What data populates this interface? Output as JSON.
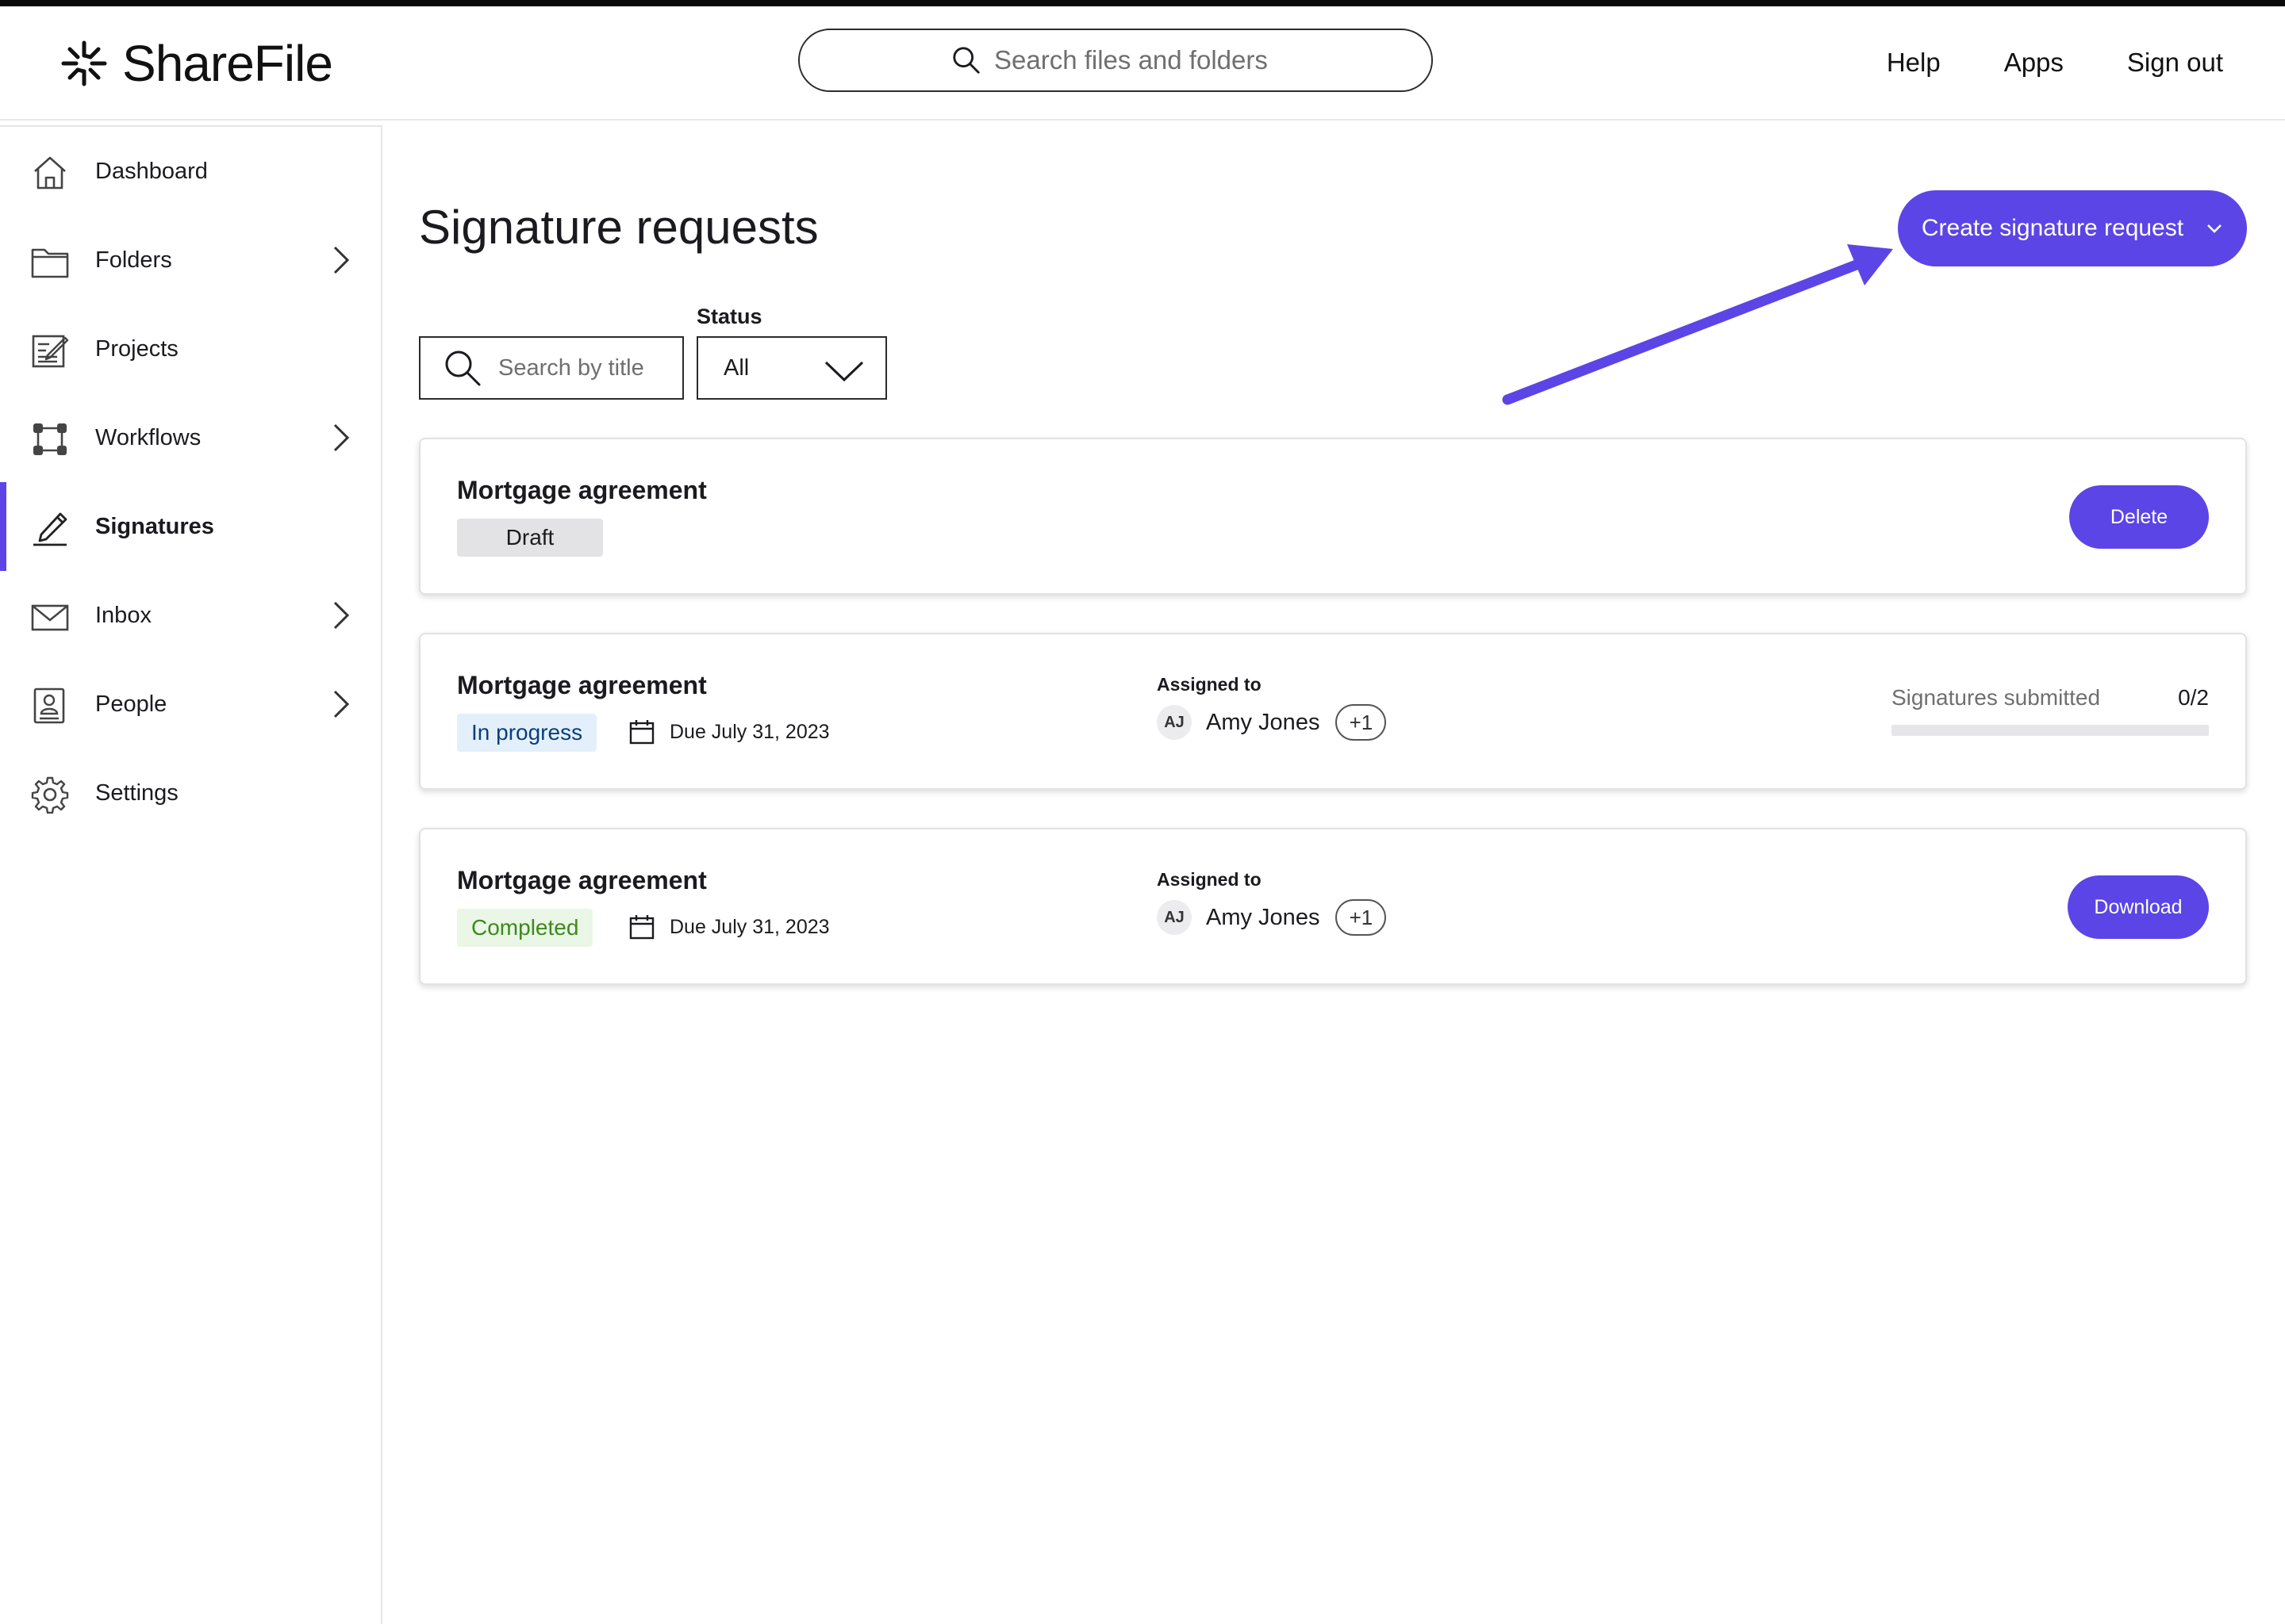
{
  "header": {
    "brand": "ShareFile",
    "search_placeholder": "Search files and folders",
    "nav": {
      "help": "Help",
      "apps": "Apps",
      "sign_out": "Sign out"
    }
  },
  "sidebar": {
    "items": [
      {
        "label": "Dashboard",
        "icon": "home-icon"
      },
      {
        "label": "Folders",
        "icon": "folder-icon",
        "expandable": true
      },
      {
        "label": "Projects",
        "icon": "projects-icon"
      },
      {
        "label": "Workflows",
        "icon": "workflows-icon",
        "expandable": true
      },
      {
        "label": "Signatures",
        "icon": "signature-pen-icon",
        "active": true
      },
      {
        "label": "Inbox",
        "icon": "envelope-icon",
        "expandable": true
      },
      {
        "label": "People",
        "icon": "contact-book-icon",
        "expandable": true
      },
      {
        "label": "Settings",
        "icon": "gear-icon"
      }
    ]
  },
  "main": {
    "title": "Signature requests",
    "create_button": "Create signature request",
    "filters": {
      "search_placeholder": "Search by title",
      "status_label": "Status",
      "status_value": "All"
    },
    "requests": [
      {
        "title": "Mortgage agreement",
        "status": "Draft",
        "action": "Delete"
      },
      {
        "title": "Mortgage agreement",
        "status": "In progress",
        "due": "Due July 31, 2023",
        "assigned_label": "Assigned to",
        "assignee_initials": "AJ",
        "assignee_name": "Amy Jones",
        "extra_assignees": "+1",
        "signatures_label": "Signatures submitted",
        "signatures_count": "0/2",
        "signatures_progress": 0
      },
      {
        "title": "Mortgage agreement",
        "status": "Completed",
        "due": "Due July 31, 2023",
        "assigned_label": "Assigned to",
        "assignee_initials": "AJ",
        "assignee_name": "Amy Jones",
        "extra_assignees": "+1",
        "action": "Download"
      }
    ]
  },
  "colors": {
    "accent": "#5b45e6",
    "badge_in_progress_bg": "#e3f0fb",
    "badge_completed_bg": "#eaf6e6",
    "badge_draft_bg": "#e3e3e6"
  }
}
